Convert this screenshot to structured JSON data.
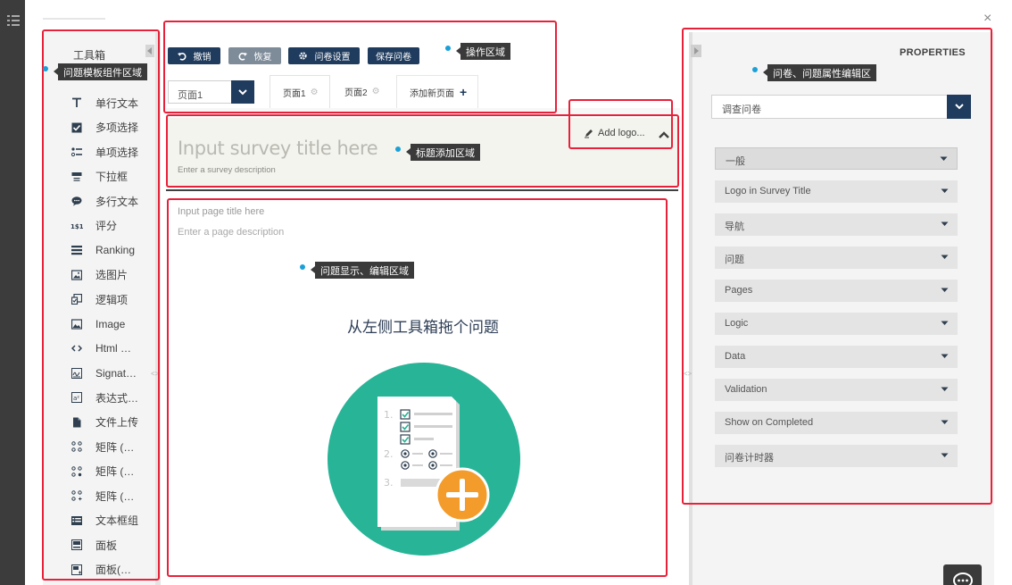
{
  "window": {
    "close_glyph": "×"
  },
  "toolbox": {
    "title": "工具箱",
    "items": [
      {
        "label": "单行文本",
        "icon": "text-icon"
      },
      {
        "label": "多项选择",
        "icon": "checkbox-icon"
      },
      {
        "label": "单项选择",
        "icon": "radiogroup-icon"
      },
      {
        "label": "下拉框",
        "icon": "dropdown-icon"
      },
      {
        "label": "多行文本",
        "icon": "comment-icon"
      },
      {
        "label": "评分",
        "icon": "rating-icon"
      },
      {
        "label": "Ranking",
        "icon": "ranking-icon"
      },
      {
        "label": "选图片",
        "icon": "imagepicker-icon"
      },
      {
        "label": "逻辑项",
        "icon": "boolean-icon"
      },
      {
        "label": "Image",
        "icon": "image-icon"
      },
      {
        "label": "Html …",
        "icon": "html-icon"
      },
      {
        "label": "Signat…",
        "icon": "signature-icon"
      },
      {
        "label": "表达式…",
        "icon": "expression-icon"
      },
      {
        "label": "文件上传",
        "icon": "file-icon"
      },
      {
        "label": "矩阵 (…",
        "icon": "matrix-icon"
      },
      {
        "label": "矩阵 (…",
        "icon": "matrix-dropdown-icon"
      },
      {
        "label": "矩阵 (…",
        "icon": "matrix-dynamic-icon"
      },
      {
        "label": "文本框组",
        "icon": "multipletext-icon"
      },
      {
        "label": "面板",
        "icon": "panel-icon"
      },
      {
        "label": "面板(…",
        "icon": "paneldynamic-icon"
      }
    ]
  },
  "toolbar": {
    "undo": "撤销",
    "redo": "恢复",
    "settings": "问卷设置",
    "save": "保存问卷"
  },
  "pages": {
    "selected": "页面1",
    "tabs": [
      "页面1",
      "页面2"
    ],
    "add_page": "添加新页面"
  },
  "survey": {
    "title_placeholder": "Input survey title here",
    "description_placeholder": "Enter a survey description",
    "add_logo": "Add logo...",
    "page_title_placeholder": "Input page title here",
    "page_description_placeholder": "Enter a page description",
    "drag_hint": "从左侧工具箱拖个问题"
  },
  "properties": {
    "title": "PROPERTIES",
    "selected_object": "调查问卷",
    "sections": [
      "一般",
      "Logo in Survey Title",
      "导航",
      "问题",
      "Pages",
      "Logic",
      "Data",
      "Validation",
      "Show on Completed",
      "问卷计时器"
    ]
  },
  "annotations": {
    "toolbox_area": "问题模板组件区域",
    "toolbar_area": "操作区域",
    "properties_area": "问卷、问题属性编辑区",
    "title_area": "标题添加区域",
    "question_area": "问题显示、编辑区域"
  },
  "colors": {
    "accent": "#1f3b5d",
    "disabled_button": "#7e8b99",
    "illustration_green": "#27b497",
    "illustration_orange": "#f39c2b",
    "annotation_red": "#e8213a"
  }
}
